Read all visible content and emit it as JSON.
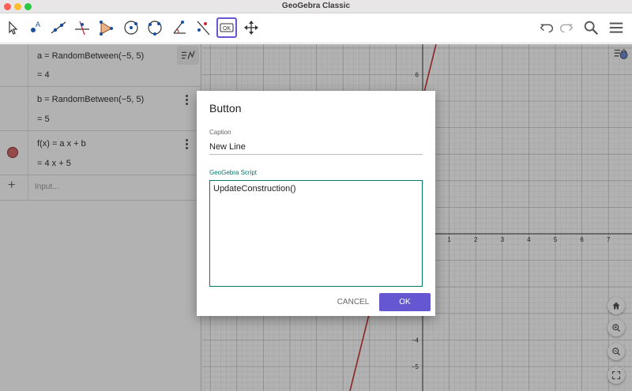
{
  "window": {
    "title": "GeoGebra Classic"
  },
  "toolbar": {
    "tools": [
      {
        "icon": "move-arrow-icon"
      },
      {
        "icon": "point-icon",
        "label": "A"
      },
      {
        "icon": "line-icon"
      },
      {
        "icon": "perpendicular-line-icon"
      },
      {
        "icon": "polygon-icon"
      },
      {
        "icon": "circle-center-point-icon"
      },
      {
        "icon": "circle-three-points-icon"
      },
      {
        "icon": "angle-icon"
      },
      {
        "icon": "reflect-line-icon"
      },
      {
        "icon": "button-tool-icon",
        "label": "OK"
      },
      {
        "icon": "move-graphics-icon"
      }
    ]
  },
  "algebra": {
    "items": [
      {
        "definition": "a  =  RandomBetween(−5, 5)",
        "value": "=  4"
      },
      {
        "definition": "b  =  RandomBetween(−5, 5)",
        "value": "=  5"
      },
      {
        "definition": "f(x)  =  a x + b",
        "value": "=   4 x + 5",
        "color": "#d96b6b"
      }
    ],
    "input_placeholder": "Input..."
  },
  "graphics": {
    "x_ticks": [
      "1",
      "2",
      "3",
      "4",
      "5",
      "6",
      "7"
    ],
    "y_ticks": [
      "6",
      "−4",
      "−5"
    ],
    "line_color": "#cc3333"
  },
  "dialog": {
    "title": "Button",
    "caption_label": "Caption",
    "caption_value": "New Line",
    "script_label": "GeoGebra Script",
    "script_value": "UpdateConstruction()",
    "cancel_label": "CANCEL",
    "ok_label": "OK"
  },
  "colors": {
    "accent": "#6557d2",
    "script_green": "#00796b"
  }
}
